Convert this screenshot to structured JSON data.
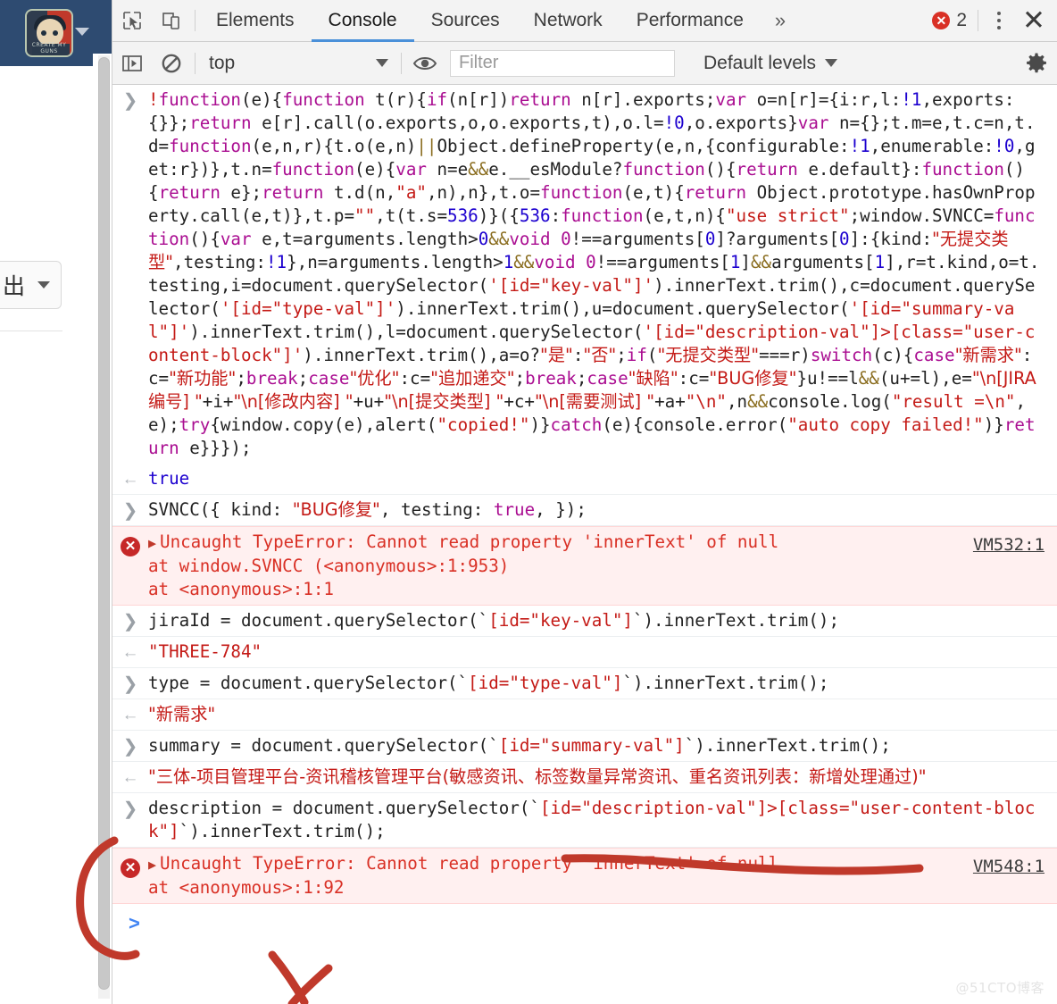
{
  "page": {
    "avatar_caption": "CREATE MY GUNS",
    "export_button_label": "出"
  },
  "devtools": {
    "tabs": [
      {
        "label": "Elements",
        "active": false
      },
      {
        "label": "Console",
        "active": true
      },
      {
        "label": "Sources",
        "active": false
      },
      {
        "label": "Network",
        "active": false
      },
      {
        "label": "Performance",
        "active": false
      }
    ],
    "more_tabs_label": "»",
    "error_badge_count": "2",
    "icons": {
      "inspect": "inspect-element-icon",
      "device": "device-toolbar-icon",
      "sidebar": "console-sidebar-icon",
      "clear": "clear-console-icon",
      "eye": "live-expression-icon",
      "settings": "gear-icon",
      "menu": "kebab-menu-icon",
      "close": "close-icon"
    },
    "filterbar": {
      "context_label": "top",
      "filter_placeholder": "Filter",
      "levels_label": "Default levels"
    },
    "prompt_symbol": ">"
  },
  "console": {
    "entries": [
      {
        "kind": "input",
        "name": "bundle-iife-input",
        "tokens": [
          {
            "t": "!",
            "c": "t-str"
          },
          {
            "t": "function",
            "c": "t-kw"
          },
          {
            "t": "(e){",
            "c": "t-plain"
          },
          {
            "t": "function",
            "c": "t-kw"
          },
          {
            "t": " t(r){",
            "c": "t-plain"
          },
          {
            "t": "if",
            "c": "t-kw"
          },
          {
            "t": "(n[r])",
            "c": "t-plain"
          },
          {
            "t": "return",
            "c": "t-kw"
          },
          {
            "t": " n[r].exports;",
            "c": "t-plain"
          },
          {
            "t": "var",
            "c": "t-kw"
          },
          {
            "t": " o=n[r]={i:r,l:",
            "c": "t-plain"
          },
          {
            "t": "!1",
            "c": "t-num"
          },
          {
            "t": ",exports:{}};",
            "c": "t-plain"
          },
          {
            "t": "return",
            "c": "t-kw"
          },
          {
            "t": " e[r].call(o.exports,o,o.exports,t),o.l=",
            "c": "t-plain"
          },
          {
            "t": "!0",
            "c": "t-num"
          },
          {
            "t": ",o.exports}",
            "c": "t-plain"
          },
          {
            "t": "var",
            "c": "t-kw"
          },
          {
            "t": " n={};t.m=e,t.c=n,t.d=",
            "c": "t-plain"
          },
          {
            "t": "function",
            "c": "t-kw"
          },
          {
            "t": "(e,n,r){t.o(e,n)",
            "c": "t-plain"
          },
          {
            "t": "||",
            "c": "t-op"
          },
          {
            "t": "Object.defineProperty(e,n,{configurable:",
            "c": "t-plain"
          },
          {
            "t": "!1",
            "c": "t-num"
          },
          {
            "t": ",enumerable:",
            "c": "t-plain"
          },
          {
            "t": "!0",
            "c": "t-num"
          },
          {
            "t": ",get:r})},t.n=",
            "c": "t-plain"
          },
          {
            "t": "function",
            "c": "t-kw"
          },
          {
            "t": "(e){",
            "c": "t-plain"
          },
          {
            "t": "var",
            "c": "t-kw"
          },
          {
            "t": " n=e",
            "c": "t-plain"
          },
          {
            "t": "&&",
            "c": "t-op"
          },
          {
            "t": "e.__esModule?",
            "c": "t-plain"
          },
          {
            "t": "function",
            "c": "t-kw"
          },
          {
            "t": "(){",
            "c": "t-plain"
          },
          {
            "t": "return",
            "c": "t-kw"
          },
          {
            "t": " e.default}:",
            "c": "t-plain"
          },
          {
            "t": "function",
            "c": "t-kw"
          },
          {
            "t": "(){",
            "c": "t-plain"
          },
          {
            "t": "return",
            "c": "t-kw"
          },
          {
            "t": " e};",
            "c": "t-plain"
          },
          {
            "t": "return",
            "c": "t-kw"
          },
          {
            "t": " t.d(n,",
            "c": "t-plain"
          },
          {
            "t": "\"a\"",
            "c": "t-str"
          },
          {
            "t": ",n),n},t.o=",
            "c": "t-plain"
          },
          {
            "t": "function",
            "c": "t-kw"
          },
          {
            "t": "(e,t){",
            "c": "t-plain"
          },
          {
            "t": "return",
            "c": "t-kw"
          },
          {
            "t": " Object.prototype.hasOwnProperty.call(e,t)},t.p=",
            "c": "t-plain"
          },
          {
            "t": "\"\"",
            "c": "t-str"
          },
          {
            "t": ",t(t.s=",
            "c": "t-plain"
          },
          {
            "t": "536",
            "c": "t-num"
          },
          {
            "t": ")}({",
            "c": "t-plain"
          },
          {
            "t": "536",
            "c": "t-num"
          },
          {
            "t": ":",
            "c": "t-plain"
          },
          {
            "t": "function",
            "c": "t-kw"
          },
          {
            "t": "(e,t,n){",
            "c": "t-plain"
          },
          {
            "t": "\"use strict\"",
            "c": "t-str"
          },
          {
            "t": ";window.SVNCC=",
            "c": "t-plain"
          },
          {
            "t": "function",
            "c": "t-kw"
          },
          {
            "t": "(){",
            "c": "t-plain"
          },
          {
            "t": "var",
            "c": "t-kw"
          },
          {
            "t": " e,t=arguments.length>",
            "c": "t-plain"
          },
          {
            "t": "0",
            "c": "t-num"
          },
          {
            "t": "&&",
            "c": "t-op"
          },
          {
            "t": "void 0",
            "c": "t-kw"
          },
          {
            "t": "!==",
            "c": "t-plain"
          },
          {
            "t": "arguments[",
            "c": "t-plain"
          },
          {
            "t": "0",
            "c": "t-num"
          },
          {
            "t": "]?arguments[",
            "c": "t-plain"
          },
          {
            "t": "0",
            "c": "t-num"
          },
          {
            "t": "]:{kind:",
            "c": "t-plain"
          },
          {
            "t": "\"无提交类型\"",
            "c": "t-str"
          },
          {
            "t": ",testing:",
            "c": "t-plain"
          },
          {
            "t": "!1",
            "c": "t-num"
          },
          {
            "t": "},n=arguments.length>",
            "c": "t-plain"
          },
          {
            "t": "1",
            "c": "t-num"
          },
          {
            "t": "&&",
            "c": "t-op"
          },
          {
            "t": "void 0",
            "c": "t-kw"
          },
          {
            "t": "!==",
            "c": "t-plain"
          },
          {
            "t": "arguments[",
            "c": "t-plain"
          },
          {
            "t": "1",
            "c": "t-num"
          },
          {
            "t": "]",
            "c": "t-plain"
          },
          {
            "t": "&&",
            "c": "t-op"
          },
          {
            "t": "arguments[",
            "c": "t-plain"
          },
          {
            "t": "1",
            "c": "t-num"
          },
          {
            "t": "],r=t.kind,o=t.testing,i=document.querySelector(",
            "c": "t-plain"
          },
          {
            "t": "'[id=\"key-val\"]'",
            "c": "t-str"
          },
          {
            "t": ").innerText.trim(),c=document.querySelector(",
            "c": "t-plain"
          },
          {
            "t": "'[id=\"type-val\"]'",
            "c": "t-str"
          },
          {
            "t": ").innerText.trim(),u=document.querySelector(",
            "c": "t-plain"
          },
          {
            "t": "'[id=\"summary-val\"]'",
            "c": "t-str"
          },
          {
            "t": ").innerText.trim(),l=document.querySelector(",
            "c": "t-plain"
          },
          {
            "t": "'[id=\"description-val\"]>[class=\"user-content-block\"]'",
            "c": "t-str"
          },
          {
            "t": ").innerText.trim(),a=o?",
            "c": "t-plain"
          },
          {
            "t": "\"是\"",
            "c": "t-str"
          },
          {
            "t": ":",
            "c": "t-plain"
          },
          {
            "t": "\"否\"",
            "c": "t-str"
          },
          {
            "t": ";",
            "c": "t-plain"
          },
          {
            "t": "if",
            "c": "t-kw"
          },
          {
            "t": "(",
            "c": "t-plain"
          },
          {
            "t": "\"无提交类型\"",
            "c": "t-str"
          },
          {
            "t": "===r)",
            "c": "t-plain"
          },
          {
            "t": "switch",
            "c": "t-kw"
          },
          {
            "t": "(c){",
            "c": "t-plain"
          },
          {
            "t": "case",
            "c": "t-kw"
          },
          {
            "t": "\"新需求\"",
            "c": "t-str"
          },
          {
            "t": ":c=",
            "c": "t-plain"
          },
          {
            "t": "\"新功能\"",
            "c": "t-str"
          },
          {
            "t": ";",
            "c": "t-plain"
          },
          {
            "t": "break",
            "c": "t-kw"
          },
          {
            "t": ";",
            "c": "t-plain"
          },
          {
            "t": "case",
            "c": "t-kw"
          },
          {
            "t": "\"优化\"",
            "c": "t-str"
          },
          {
            "t": ":c=",
            "c": "t-plain"
          },
          {
            "t": "\"追加递交\"",
            "c": "t-str"
          },
          {
            "t": ";",
            "c": "t-plain"
          },
          {
            "t": "break",
            "c": "t-kw"
          },
          {
            "t": ";",
            "c": "t-plain"
          },
          {
            "t": "case",
            "c": "t-kw"
          },
          {
            "t": "\"缺陷\"",
            "c": "t-str"
          },
          {
            "t": ":c=",
            "c": "t-plain"
          },
          {
            "t": "\"BUG修复\"",
            "c": "t-str"
          },
          {
            "t": "}u!==l",
            "c": "t-plain"
          },
          {
            "t": "&&",
            "c": "t-op"
          },
          {
            "t": "(u+=l),e=",
            "c": "t-plain"
          },
          {
            "t": "\"\\n[JIRA编号] \"",
            "c": "t-str"
          },
          {
            "t": "+i+",
            "c": "t-plain"
          },
          {
            "t": "\"\\n[修改内容] \"",
            "c": "t-str"
          },
          {
            "t": "+u+",
            "c": "t-plain"
          },
          {
            "t": "\"\\n[提交类型] \"",
            "c": "t-str"
          },
          {
            "t": "+c+",
            "c": "t-plain"
          },
          {
            "t": "\"\\n[需要测试] \"",
            "c": "t-str"
          },
          {
            "t": "+a+",
            "c": "t-plain"
          },
          {
            "t": "\"\\n\"",
            "c": "t-str"
          },
          {
            "t": ",n",
            "c": "t-plain"
          },
          {
            "t": "&&",
            "c": "t-op"
          },
          {
            "t": "console.log(",
            "c": "t-plain"
          },
          {
            "t": "\"result =\\n\"",
            "c": "t-str"
          },
          {
            "t": ",e);",
            "c": "t-plain"
          },
          {
            "t": "try",
            "c": "t-kw"
          },
          {
            "t": "{window.copy(e),alert(",
            "c": "t-plain"
          },
          {
            "t": "\"copied!\"",
            "c": "t-str"
          },
          {
            "t": ")}",
            "c": "t-plain"
          },
          {
            "t": "catch",
            "c": "t-kw"
          },
          {
            "t": "(e){console.error(",
            "c": "t-plain"
          },
          {
            "t": "\"auto copy failed!\"",
            "c": "t-str"
          },
          {
            "t": ")}",
            "c": "t-plain"
          },
          {
            "t": "return",
            "c": "t-kw"
          },
          {
            "t": " e}}});",
            "c": "t-plain"
          }
        ]
      },
      {
        "kind": "output",
        "name": "result-true",
        "value": "true",
        "value_class": "reply-kw"
      },
      {
        "kind": "input",
        "name": "svncc-call-input",
        "tokens": [
          {
            "t": "SVNCC({ kind: ",
            "c": "t-plain"
          },
          {
            "t": "\"BUG修复\"",
            "c": "t-str"
          },
          {
            "t": ", testing: ",
            "c": "t-plain"
          },
          {
            "t": "true",
            "c": "t-kw"
          },
          {
            "t": ", });",
            "c": "t-plain"
          }
        ]
      },
      {
        "kind": "error",
        "name": "typeerror-svncc",
        "message": "Uncaught TypeError: Cannot read property 'innerText' of null",
        "stack": [
          "at window.SVNCC (<anonymous>:1:953)",
          "at <anonymous>:1:1"
        ],
        "source_link": "VM532:1"
      },
      {
        "kind": "input",
        "name": "jiraid-input",
        "tokens": [
          {
            "t": "jiraId = document.querySelector(`",
            "c": "t-plain"
          },
          {
            "t": "[id=\"key-val\"]",
            "c": "t-str"
          },
          {
            "t": "`).innerText.trim();",
            "c": "t-plain"
          }
        ]
      },
      {
        "kind": "output",
        "name": "jiraid-result",
        "value": "\"THREE-784\"",
        "value_class": "reply-str"
      },
      {
        "kind": "input",
        "name": "type-input",
        "tokens": [
          {
            "t": "type = document.querySelector(`",
            "c": "t-plain"
          },
          {
            "t": "[id=\"type-val\"]",
            "c": "t-str"
          },
          {
            "t": "`).innerText.trim();",
            "c": "t-plain"
          }
        ]
      },
      {
        "kind": "output",
        "name": "type-result",
        "value": "\"新需求\"",
        "value_class": "reply-str"
      },
      {
        "kind": "input",
        "name": "summary-input",
        "tokens": [
          {
            "t": "summary = document.querySelector(`",
            "c": "t-plain"
          },
          {
            "t": "[id=\"summary-val\"]",
            "c": "t-str"
          },
          {
            "t": "`).innerText.trim();",
            "c": "t-plain"
          }
        ]
      },
      {
        "kind": "output",
        "name": "summary-result",
        "value": "\"三体-项目管理平台-资讯稽核管理平台(敏感资讯、标签数量异常资讯、重名资讯列表：新增处理通过)\"",
        "value_class": "reply-str"
      },
      {
        "kind": "input",
        "name": "description-input",
        "tokens": [
          {
            "t": "description = document.querySelector(`",
            "c": "t-plain"
          },
          {
            "t": "[id=\"description-val\"]>[class=\"user-content-block\"]",
            "c": "t-str"
          },
          {
            "t": "`).innerText.trim();",
            "c": "t-plain"
          }
        ]
      },
      {
        "kind": "error",
        "name": "typeerror-description",
        "message": "Uncaught TypeError: Cannot read property 'innerText' of null",
        "stack": [
          "at <anonymous>:1:92"
        ],
        "source_link": "VM548:1"
      }
    ]
  },
  "annotations": {
    "underline_color": "#c0392b",
    "bracket_color": "#c0392b",
    "check_color": "#c0392b"
  },
  "watermark": "@51CTO博客"
}
